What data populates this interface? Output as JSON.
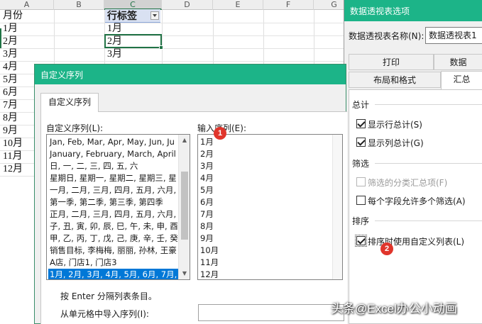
{
  "sheet": {
    "columns": [
      "A",
      "B",
      "C",
      "D",
      "E",
      "F",
      "G"
    ],
    "col_a_values": [
      "月份",
      "1月",
      "2月",
      "3月",
      "4月",
      "5月",
      "6月",
      "7月",
      "8月",
      "9月",
      "10月",
      "11月",
      "12月"
    ],
    "pivot_header": "行标签",
    "col_c_values": [
      "1月",
      "2月",
      "3月"
    ],
    "accent_color": "#217346"
  },
  "pivot_options": {
    "title": "数据透视表选项",
    "name_label": "数据透视表名称(N):",
    "name_value": "数据透视表1",
    "tabs_row1": [
      "打印",
      "数据"
    ],
    "tabs_row2": [
      "布局和格式",
      "汇总"
    ],
    "sections": {
      "totals": "总计",
      "filters": "筛选",
      "sorting": "排序"
    },
    "options": {
      "show_row_totals": "显示行总计(S)",
      "show_col_totals": "显示列总计(G)",
      "filtered_subtotals": "筛选的分类汇总项(F)",
      "multiple_filters": "每个字段允许多个筛选(A)",
      "use_custom_lists": "排序时使用自定义列表(L)"
    },
    "titlebar_color": "#1cb488"
  },
  "custom_list_dialog": {
    "title": "自定义序列",
    "tab": "自定义序列",
    "lists_label": "自定义序列(L):",
    "entries_label": "输入序列(E):",
    "lists": [
      "Jan, Feb, Mar, Apr, May, Jun, Ju",
      "January, February, March, April",
      "日, 一, 二, 三, 四, 五, 六",
      "星期日, 星期一, 星期二, 星期三, 星",
      "一月, 二月, 三月, 四月, 五月, 六月,",
      "第一季, 第二季, 第三季, 第四季",
      "正月, 二月, 三月, 四月, 五月, 六月,",
      "子, 丑, 寅, 卯, 辰, 巳, 午, 未, 申, 酉",
      "甲, 乙, 丙, 丁, 戊, 己, 庚, 辛, 壬, 癸",
      "销售目标, 李梅梅, 丽丽, 孙林, 王豪",
      "A店, 门店1, 门店3",
      "1月, 2月, 3月, 4月, 5月, 6月, 7月,"
    ],
    "entries": [
      "1月",
      "2月",
      "3月",
      "4月",
      "5月",
      "6月",
      "7月",
      "8月",
      "9月",
      "10月",
      "11月",
      "12月"
    ],
    "hint": "按 Enter 分隔列表条目。",
    "import_label": "从单元格中导入序列(I):",
    "selection_color": "#0078d7"
  },
  "callouts": {
    "one": "1",
    "two": "2"
  },
  "watermark": "头条@Excel办公小动画"
}
